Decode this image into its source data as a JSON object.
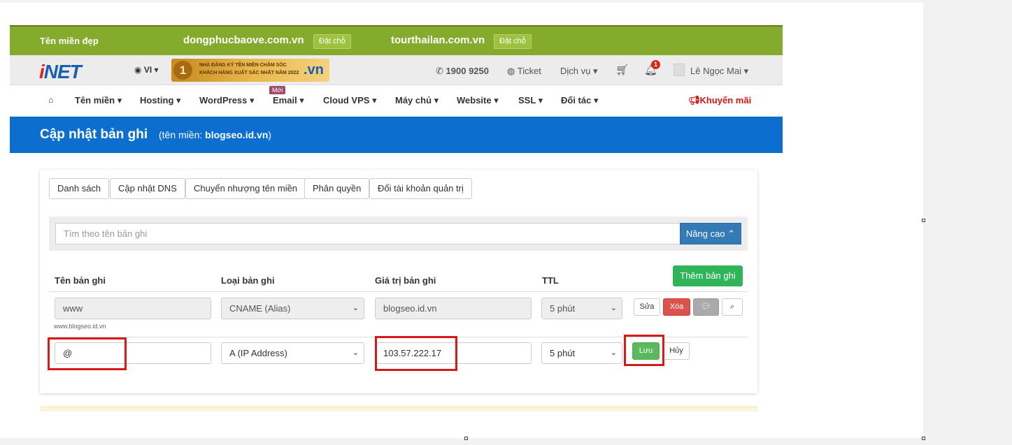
{
  "promo": {
    "label": "Tên miền đẹp",
    "domains": [
      {
        "name": "dongphucbaove.com.vn",
        "button": "Đặt chỗ"
      },
      {
        "name": "tourthailan.com.vn",
        "button": "Đặt chỗ"
      }
    ]
  },
  "header": {
    "logo_i": "i",
    "logo_rest": "NET",
    "language": "VI",
    "award_rank": "1",
    "award_line1": "NHÀ ĐĂNG KÝ TÊN MIỀN CHĂM SÓC",
    "award_line2": "KHÁCH HÀNG XUẤT SẮC NHẤT NĂM 2022",
    "award_brand": ".vn",
    "phone": "1900 9250",
    "ticket": "Ticket",
    "services": "Dịch vụ",
    "notification_count": "1",
    "user": "Lê Ngọc Mai"
  },
  "nav": {
    "items": [
      "Tên miền",
      "Hosting",
      "WordPress",
      "Email",
      "Cloud VPS",
      "Máy chủ",
      "Website",
      "SSL",
      "Đối tác"
    ],
    "new_badge": "Mới",
    "promotion": "Khuyến mãi"
  },
  "banner": {
    "title": "Cập nhật bản ghi",
    "subtitle_prefix": "(tên miền: ",
    "domain": "blogseo.id.vn",
    "subtitle_suffix": ")"
  },
  "tabs": [
    "Danh sách",
    "Cập nhật DNS",
    "Chuyển nhượng tên miền",
    "Phân quyền",
    "Đổi tài khoản quản trị"
  ],
  "search": {
    "placeholder": "Tìm theo tên bản ghi",
    "advanced_label": "Nâng cao"
  },
  "table": {
    "headers": [
      "Tên bản ghi",
      "Loại bản ghi",
      "Giá trị bản ghi",
      "TTL"
    ],
    "add_button": "Thêm bản ghi",
    "row1": {
      "name": "www",
      "type": "CNAME (Alias)",
      "value": "blogseo.id.vn",
      "ttl": "5 phút",
      "hint": "www.blogseo.id.vn",
      "edit": "Sửa",
      "delete": "Xóa"
    },
    "row2": {
      "name": "@",
      "type": "A (IP Address)",
      "value": "103.57.222.17",
      "ttl": "5 phút",
      "save": "Lưu",
      "cancel": "Hủy"
    }
  },
  "colors": {
    "promo_green": "#84ab2c",
    "banner_blue": "#0c6fcf",
    "add_green": "#2fb45a",
    "delete_red": "#d9534f",
    "highlight_red": "#d51a1a"
  }
}
